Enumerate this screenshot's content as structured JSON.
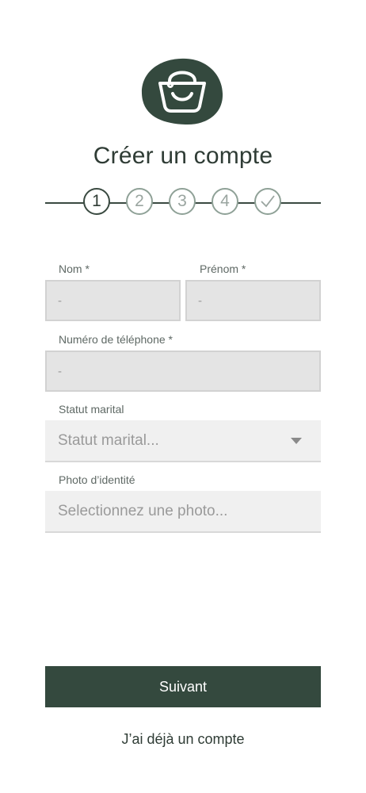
{
  "header": {
    "logo_icon": "shopping-bag-icon",
    "title": "Créer un compte",
    "accent_color": "#34493e"
  },
  "stepper": {
    "current_step": 1,
    "steps": [
      "1",
      "2",
      "3",
      "4"
    ],
    "final_step_icon": "checkmark-icon"
  },
  "form": {
    "nom": {
      "label": "Nom *",
      "value": "-"
    },
    "prenom": {
      "label": "Prénom *",
      "value": "-"
    },
    "telephone": {
      "label": "Numéro de téléphone *",
      "value": "-"
    },
    "statut": {
      "label": "Statut marital",
      "placeholder": "Statut marital..."
    },
    "photo": {
      "label": "Photo d’identité",
      "placeholder": "Selectionnez une photo..."
    }
  },
  "actions": {
    "next_label": "Suivant",
    "login_link": "J’ai déjà un compte"
  }
}
